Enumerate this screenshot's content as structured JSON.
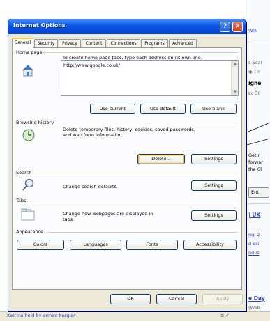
{
  "background": {
    "fragments": [
      "Wel",
      "s Sear",
      "Th",
      "igne",
      "kc 30",
      "Get r",
      "forwar",
      "the Cl",
      "| UK",
      "ng: 2",
      "d exi",
      "nd is",
      "e Day",
      "(Web"
    ],
    "button_fragment": "Ent",
    "status_text": "Katrina held by armed burglar",
    "status_icons": "≡ ✓"
  },
  "dialog": {
    "title": "Internet Options",
    "help_glyph": "?",
    "close_glyph": "×",
    "tabs": [
      "General",
      "Security",
      "Privacy",
      "Content",
      "Connections",
      "Programs",
      "Advanced"
    ],
    "active_tab": "General",
    "home_page": {
      "label": "Home page",
      "description": "To create home page tabs, type each address on its own line.",
      "url": "http://www.google.co.uk/",
      "buttons": {
        "use_current": "Use current",
        "use_default": "Use default",
        "use_blank": "Use blank"
      }
    },
    "browsing_history": {
      "label": "Browsing history",
      "description_1": "Delete temporary files, history, cookies, saved passwords,",
      "description_2": "and web form information.",
      "buttons": {
        "delete": "Delete...",
        "settings": "Settings"
      }
    },
    "search": {
      "label": "Search",
      "description": "Change search defaults.",
      "buttons": {
        "settings": "Settings"
      }
    },
    "tabs_group": {
      "label": "Tabs",
      "description_1": "Change how webpages are displayed in",
      "description_2": "tabs.",
      "buttons": {
        "settings": "Settings"
      }
    },
    "appearance": {
      "label": "Appearance",
      "buttons": {
        "colors": "Colors",
        "languages": "Languages",
        "fonts": "Fonts",
        "accessibility": "Accessibility"
      }
    },
    "footer": {
      "ok": "OK",
      "cancel": "Cancel",
      "apply": "Apply"
    }
  },
  "colors": {
    "title_blue": "#0a55e3",
    "focus_orange": "#f7b64a",
    "link_blue": "#2a45c4"
  }
}
